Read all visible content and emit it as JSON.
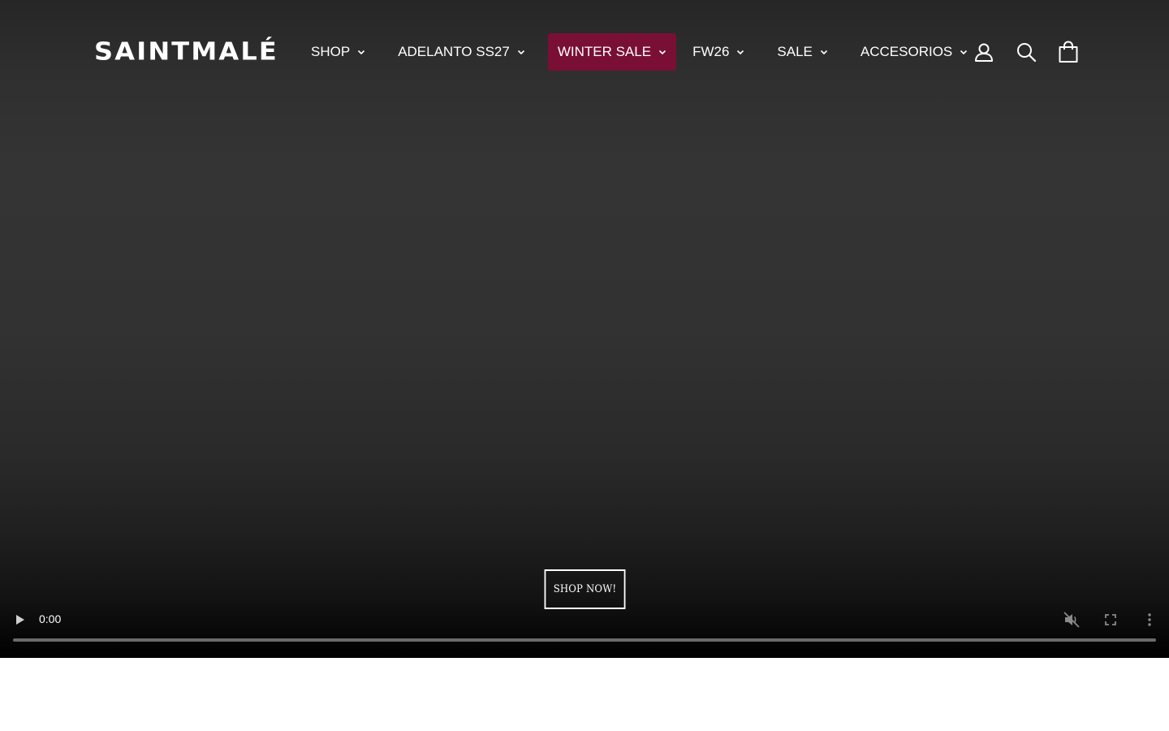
{
  "brand": {
    "logo_text": "SAINTMALÉ"
  },
  "nav": {
    "items": [
      {
        "label": "SHOP"
      },
      {
        "label": "ADELANTO SS27"
      },
      {
        "label": "WINTER SALE",
        "active": true
      },
      {
        "label": "FW26"
      },
      {
        "label": "SALE"
      },
      {
        "label": "ACCESORIOS"
      }
    ]
  },
  "header_icons": [
    "account-icon",
    "search-icon",
    "cart-icon"
  ],
  "hero": {
    "cta_label": "SHOP NOW!"
  },
  "video": {
    "time": "0:00",
    "progress": 0,
    "controls": [
      "play-icon",
      "muted-icon",
      "fullscreen-icon",
      "more-vertical-icon"
    ]
  },
  "colors": {
    "accent": "#7a0f35",
    "text": "#ffffff",
    "hero_bg": "#333333"
  }
}
